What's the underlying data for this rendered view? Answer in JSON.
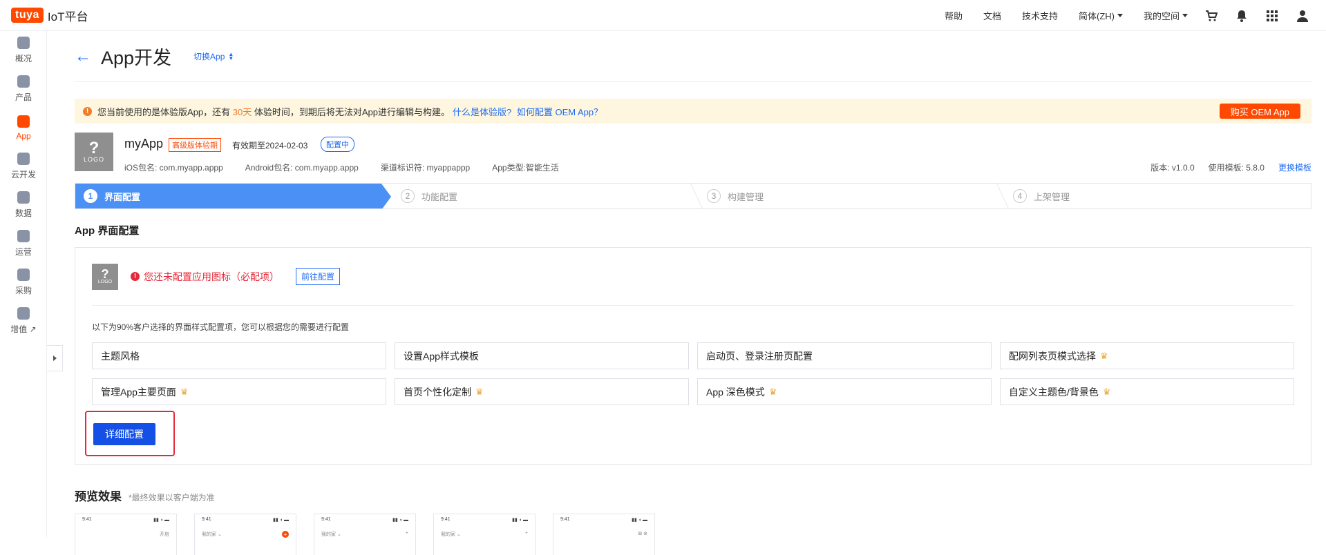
{
  "brand": {
    "badge": "tuya",
    "name": "IoT平台"
  },
  "topnav": {
    "help": "帮助",
    "docs": "文档",
    "support": "技术支持",
    "language": "简体(ZH)",
    "space": "我的空间"
  },
  "sidebar": {
    "items": [
      {
        "label": "概况"
      },
      {
        "label": "产品"
      },
      {
        "label": "App"
      },
      {
        "label": "云开发"
      },
      {
        "label": "数据"
      },
      {
        "label": "运营"
      },
      {
        "label": "采购"
      },
      {
        "label": "增值 ↗"
      }
    ]
  },
  "header": {
    "back": "←",
    "title": "App开发",
    "switch": "切换App"
  },
  "banner": {
    "text_before": "您当前使用的是体验版App，还有",
    "days": "30天",
    "text_after": "体验时间，到期后将无法对App进行编辑与构建。",
    "link1": "什么是体验版?",
    "link2": "如何配置 OEM App？",
    "buy": "购买 OEM App"
  },
  "app": {
    "logo_q": "?",
    "logo_text": "LOGO",
    "name": "myApp",
    "trial_badge": "高级版体验期",
    "valid": "有效期至2024-02-03",
    "status_badge": "配置中",
    "ios": "iOS包名: com.myapp.appp",
    "android": "Android包名: com.myapp.appp",
    "channel": "渠道标识符: myappappp",
    "type": "App类型:智能生活",
    "version": "版本: v1.0.0",
    "template": "使用模板: 5.8.0",
    "change_template": "更换模板"
  },
  "steps": [
    {
      "num": "1",
      "label": "界面配置"
    },
    {
      "num": "2",
      "label": "功能配置"
    },
    {
      "num": "3",
      "label": "构建管理"
    },
    {
      "num": "4",
      "label": "上架管理"
    }
  ],
  "config": {
    "section_title": "App 界面配置",
    "warning": "您还未配置应用图标（必配项）",
    "goto": "前往配置",
    "hint": "以下为90%客户选择的界面样式配置项，您可以根据您的需要进行配置",
    "items": [
      {
        "label": "主题风格",
        "crown": ""
      },
      {
        "label": "设置App样式模板",
        "crown": ""
      },
      {
        "label": "启动页、登录注册页配置",
        "crown": ""
      },
      {
        "label": "配网列表页模式选择",
        "crown": "♛"
      },
      {
        "label": "管理App主要页面",
        "crown": "♛"
      },
      {
        "label": "首页个性化定制",
        "crown": "♛"
      },
      {
        "label": "App 深色模式",
        "crown": "♛"
      },
      {
        "label": "自定义主题色/背景色",
        "crown": "♛"
      }
    ],
    "detail_button": "详细配置"
  },
  "preview": {
    "title": "预览效果",
    "note": "*最终效果以客户端为准",
    "phones": [
      {
        "time": "9:41",
        "left": "",
        "right": "开启"
      },
      {
        "time": "9:41",
        "left": "我的家 ⌄",
        "right": "+"
      },
      {
        "time": "9:41",
        "left": "我的家 ⌄",
        "right": "+"
      },
      {
        "time": "9:41",
        "left": "我的家 ⌄",
        "right": "+"
      },
      {
        "time": "9:41",
        "left": "",
        "right": "⊠ ⊗"
      }
    ]
  },
  "colors": {
    "brand": "#ff4800",
    "link": "#1e6bf5",
    "step_active": "#4a90f5",
    "error": "#e5283a"
  }
}
